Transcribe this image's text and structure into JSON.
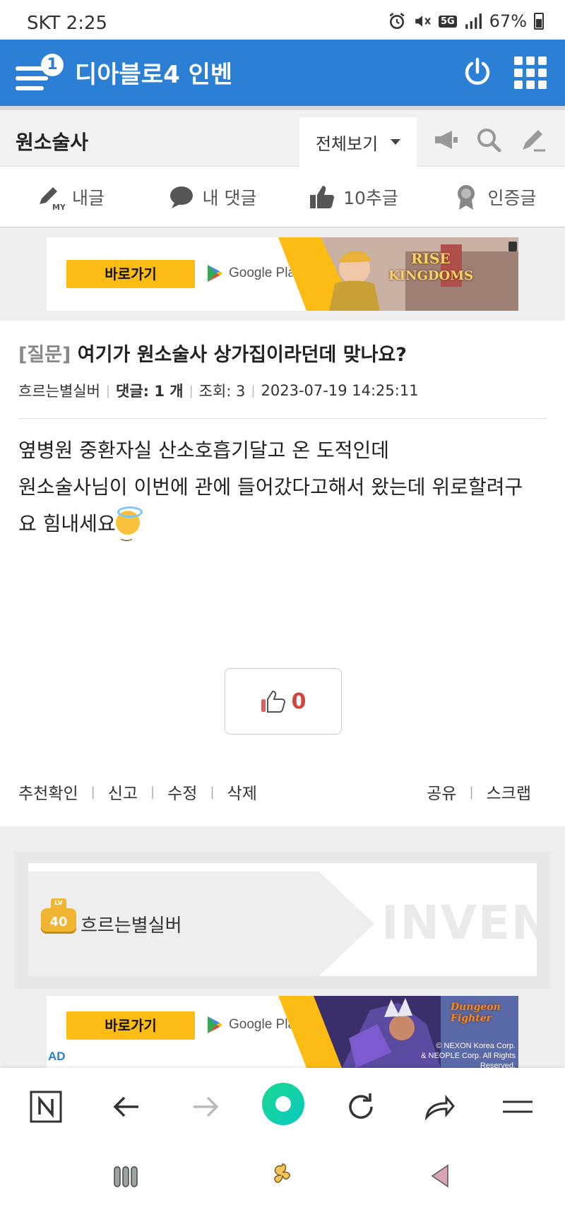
{
  "status_bar": {
    "carrier_time": "SKT 2:25",
    "network": "5G",
    "battery": "67%"
  },
  "header": {
    "title": "디아블로4 인벤",
    "menu_badge": "1"
  },
  "board_bar": {
    "board_name": "원소술사",
    "view_filter": "전체보기"
  },
  "quick_menu": [
    {
      "label": "내글",
      "icon": "my-post-pencil-icon"
    },
    {
      "label": "내 댓글",
      "icon": "comment-bubble-icon"
    },
    {
      "label": "10추글",
      "icon": "thumbs-up-icon"
    },
    {
      "label": "인증글",
      "icon": "medal-icon"
    }
  ],
  "ad_top": {
    "button": "바로가기",
    "store": "Google Play",
    "game": [
      "RISE",
      "KINGDOMS"
    ]
  },
  "post": {
    "tag": "[질문]",
    "title": "여기가 원소술사 상가집이라던데 맞나요?",
    "author": "흐르는별실버",
    "comments_label": "댓글: 1 개",
    "views": "조회: 3",
    "date": "2023-07-19 14:25:11",
    "body_lines": [
      "옆병원 중환자실 산소호흡기달고 온 도적인데",
      "원소술사님이 이번에 관에 들어갔다고해서 왔는데 위로할려구",
      "요 힘내세요"
    ],
    "likes": "0"
  },
  "actions": {
    "left": [
      "추천확인",
      "신고",
      "수정",
      "삭제"
    ],
    "right": [
      "공유",
      "스크랩"
    ]
  },
  "author_card": {
    "level": "40",
    "name": "흐르는별실버",
    "watermark": "INVEN"
  },
  "ad_bottom": {
    "button": "바로가기",
    "store": "Google Play",
    "ad_label": "AD",
    "game": "Dungeon Fighter",
    "copyright_lines": [
      "© NEXON Korea Corp.",
      "& NEOPLE Corp. All Rights Reserved."
    ]
  },
  "colors": {
    "brand_blue": "#2b7fd4",
    "ad_yellow": "#fdbc13",
    "like_red": "#d0453a"
  }
}
